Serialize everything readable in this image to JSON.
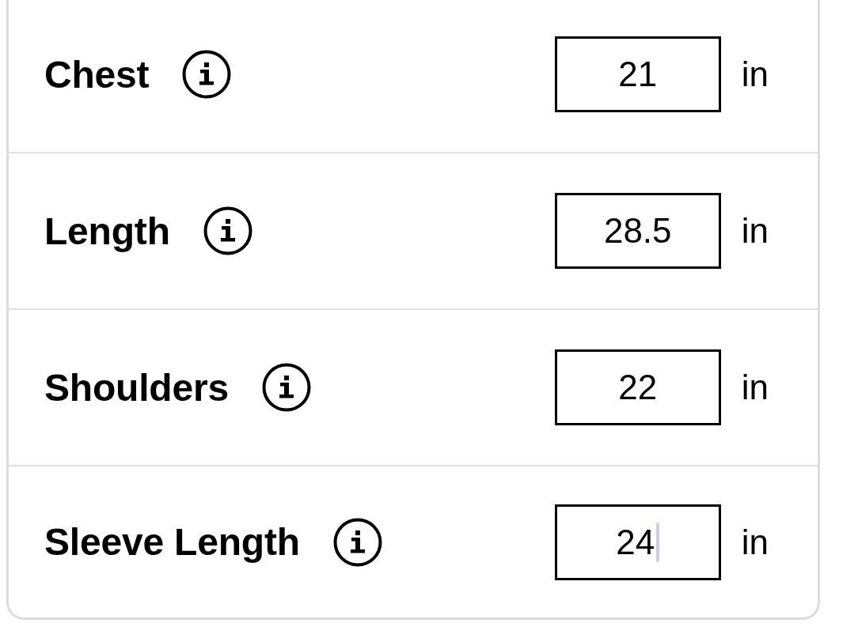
{
  "measurements": [
    {
      "label": "Chest",
      "value": "21",
      "unit": "in",
      "focused": false
    },
    {
      "label": "Length",
      "value": "28.5",
      "unit": "in",
      "focused": false
    },
    {
      "label": "Shoulders",
      "value": "22",
      "unit": "in",
      "focused": false
    },
    {
      "label": "Sleeve Length",
      "value": "24",
      "unit": "in",
      "focused": true
    }
  ]
}
